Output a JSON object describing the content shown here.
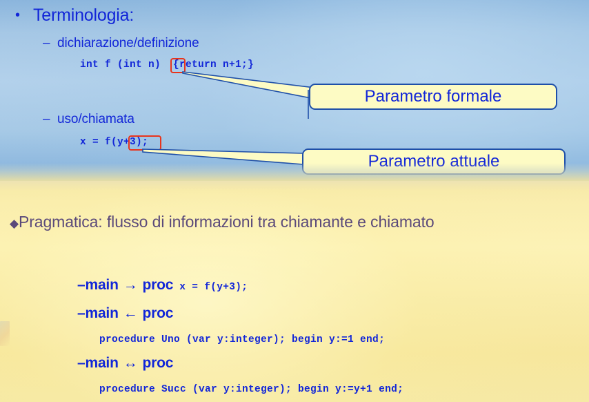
{
  "theme": {
    "text_blue": "#1226d8",
    "callout_fill": "#fdfbc4",
    "callout_border": "#1f4fa8",
    "highlight_red": "#e8341c",
    "pragma_purple": "#5b4a7a",
    "slide_top_bg": "#a9cbe7",
    "slide_bottom_bg": "#faeeb0"
  },
  "slide_top": {
    "bullet_glyph": "•",
    "dash_glyph": "–",
    "heading": "Terminologia:",
    "items": [
      {
        "label": "dichiarazione/definizione",
        "code": "int f (int n)  {return n+1;}",
        "highlight_token": "n",
        "callout": "Parametro formale"
      },
      {
        "label": "uso/chiamata",
        "code": "x = f(y+3);",
        "highlight_token": "(y+3",
        "callout": "Parametro attuale"
      }
    ]
  },
  "slide_bottom": {
    "diamond_glyph": "◆",
    "heading": "Pragmatica: flusso di informazioni tra chiamante e chiamato",
    "rows": [
      {
        "dash": "–",
        "from": "main",
        "arrow": "→",
        "to": "proc",
        "inline_code": "x = f(y+3);",
        "code": ""
      },
      {
        "dash": "–",
        "from": "main",
        "arrow": "←",
        "to": "proc",
        "inline_code": "",
        "code": "procedure Uno (var y:integer); begin y:=1 end;"
      },
      {
        "dash": "–",
        "from": "main",
        "arrow": "↔",
        "to": "proc",
        "inline_code": "",
        "code": "procedure Succ (var y:integer); begin y:=y+1 end;"
      }
    ]
  }
}
